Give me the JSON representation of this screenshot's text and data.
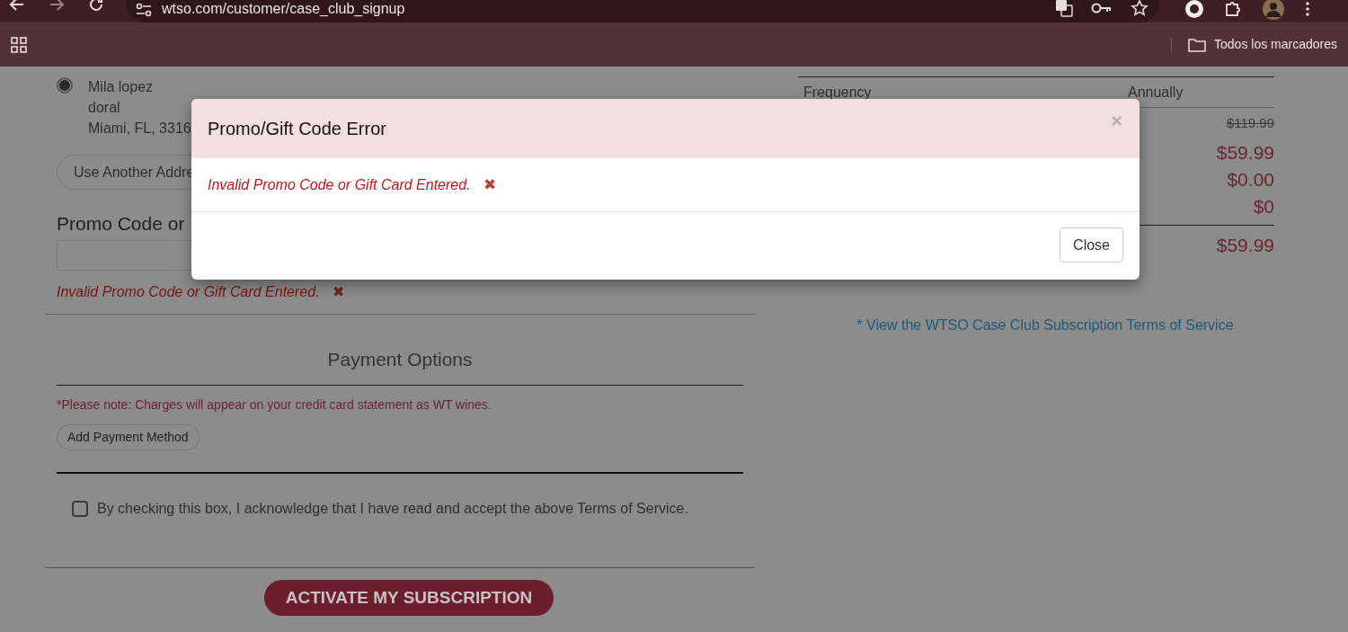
{
  "browser": {
    "url": "wtso.com/customer/case_club_signup",
    "bookmarks_label": "Todos los marcadores"
  },
  "address": {
    "selected": true,
    "lines": [
      "Mila lopez",
      "doral",
      "Miami, FL, 3316"
    ]
  },
  "use_another_address_button": "Use Another Addre",
  "promo": {
    "label": "Promo Code or",
    "error": "Invalid Promo Code or Gift Card Entered."
  },
  "payment": {
    "title": "Payment Options",
    "note": "*Please note: Charges will appear on your credit card statement as WT wines.",
    "add_button": "Add Payment Method"
  },
  "terms_checkbox": {
    "label": "By checking this box, I acknowledge that I have read and accept the above Terms of Service.",
    "checked": false
  },
  "activate_button": "ACTIVATE MY SUBSCRIPTION",
  "summary": {
    "header": {
      "label": "Frequency",
      "value": "Annually"
    },
    "prices": [
      {
        "text": "$119.99",
        "struck": true
      },
      {
        "text": "$59.99",
        "struck": false
      },
      {
        "text": "$0.00",
        "struck": false
      },
      {
        "text": "$0",
        "struck": false
      }
    ],
    "total": "$59.99"
  },
  "terms_link": "* View the WTSO Case Club Subscription Terms of Service",
  "modal": {
    "title": "Promo/Gift Code Error",
    "close_glyph": "×",
    "message": "Invalid Promo Code or Gift Card Entered.",
    "message_glyph": "✖",
    "close_button": "Close"
  }
}
